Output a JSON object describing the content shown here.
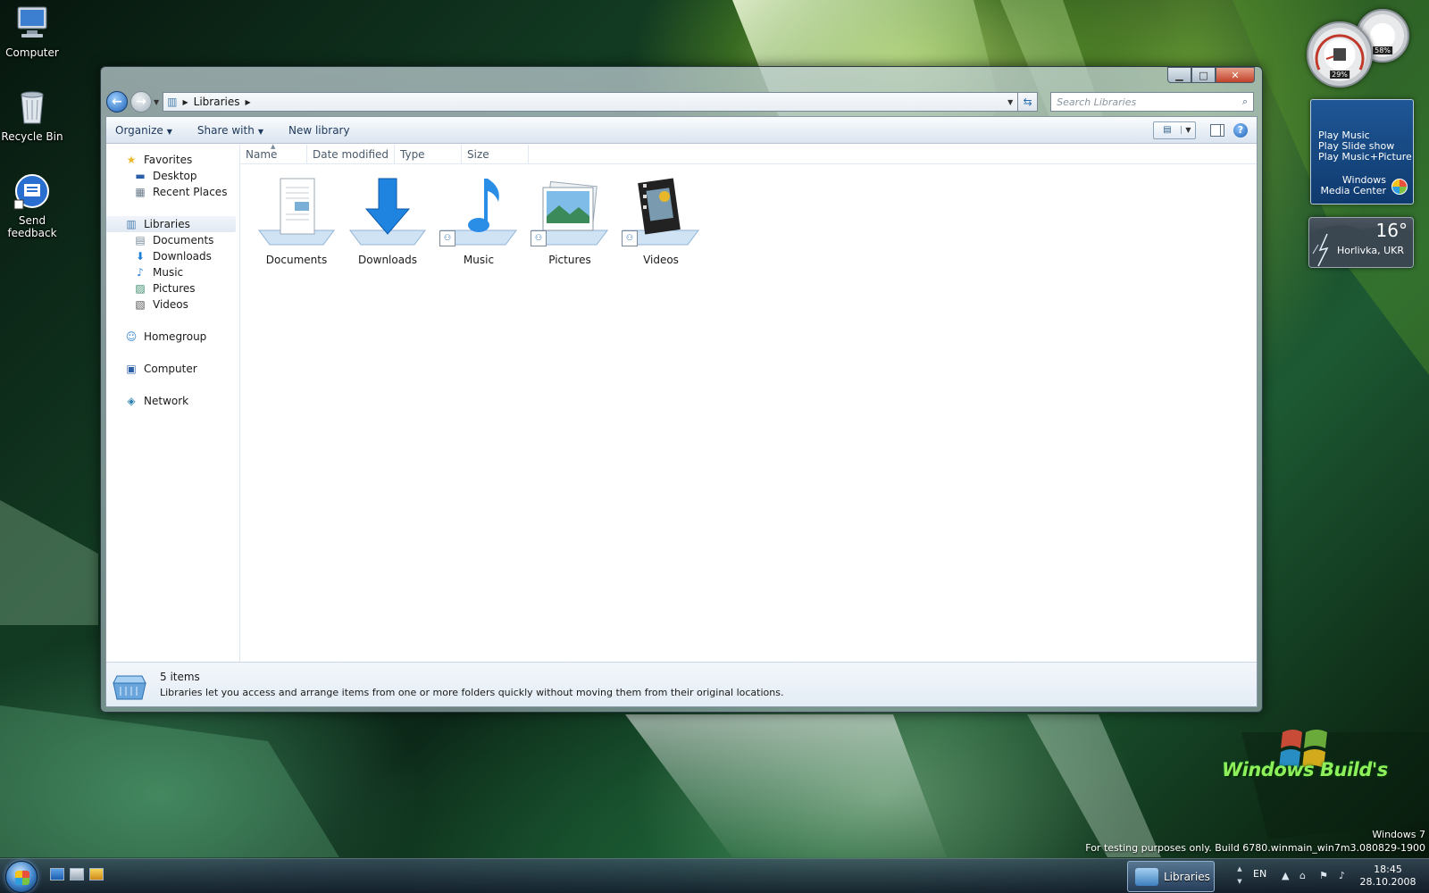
{
  "desktop": {
    "icons": [
      {
        "label": "Computer"
      },
      {
        "label": "Recycle Bin"
      },
      {
        "label": "Send feedback"
      }
    ]
  },
  "window": {
    "address": {
      "crumb": "Libraries"
    },
    "search": {
      "placeholder": "Search Libraries"
    },
    "toolbar": {
      "organize": "Organize",
      "share_with": "Share with",
      "new_library": "New library"
    },
    "nav": {
      "favorites": "Favorites",
      "desktop": "Desktop",
      "recent_places": "Recent Places",
      "libraries": "Libraries",
      "documents": "Documents",
      "downloads": "Downloads",
      "music": "Music",
      "pictures": "Pictures",
      "videos": "Videos",
      "homegroup": "Homegroup",
      "computer": "Computer",
      "network": "Network"
    },
    "columns": {
      "name": "Name",
      "date_modified": "Date modified",
      "type": "Type",
      "size": "Size"
    },
    "items": [
      {
        "label": "Documents",
        "icon": "documents-library-icon"
      },
      {
        "label": "Downloads",
        "icon": "downloads-library-icon"
      },
      {
        "label": "Music",
        "icon": "music-library-icon"
      },
      {
        "label": "Pictures",
        "icon": "pictures-library-icon"
      },
      {
        "label": "Videos",
        "icon": "videos-library-icon"
      }
    ],
    "details": {
      "count": "5 items",
      "description": "Libraries let you access and arrange items from one or more folders quickly without moving them from their original locations."
    }
  },
  "gadgets": {
    "cpu_meter": {
      "cpu": "29%",
      "memory": "58%"
    },
    "media_center": {
      "play_music": "Play Music",
      "play_slideshow": "Play Slide show",
      "play_music_picture": "Play Music+Picture",
      "brand_line1": "Windows",
      "brand_line2": "Media Center"
    },
    "weather": {
      "temp": "16°",
      "city": "Horlivka, UKR"
    }
  },
  "watermark": "Windows Build's",
  "build": {
    "line1": "Windows 7",
    "line2": "For testing purposes only. Build 6780.winmain_win7m3.080829-1900"
  },
  "taskbar": {
    "task_label": "Libraries",
    "lang": "EN",
    "time": "18:45",
    "date": "28.10.2008"
  },
  "colors": {
    "accent": "#1e395b",
    "taskbar": "#1e2d3f",
    "watermark": "#8df05a"
  }
}
